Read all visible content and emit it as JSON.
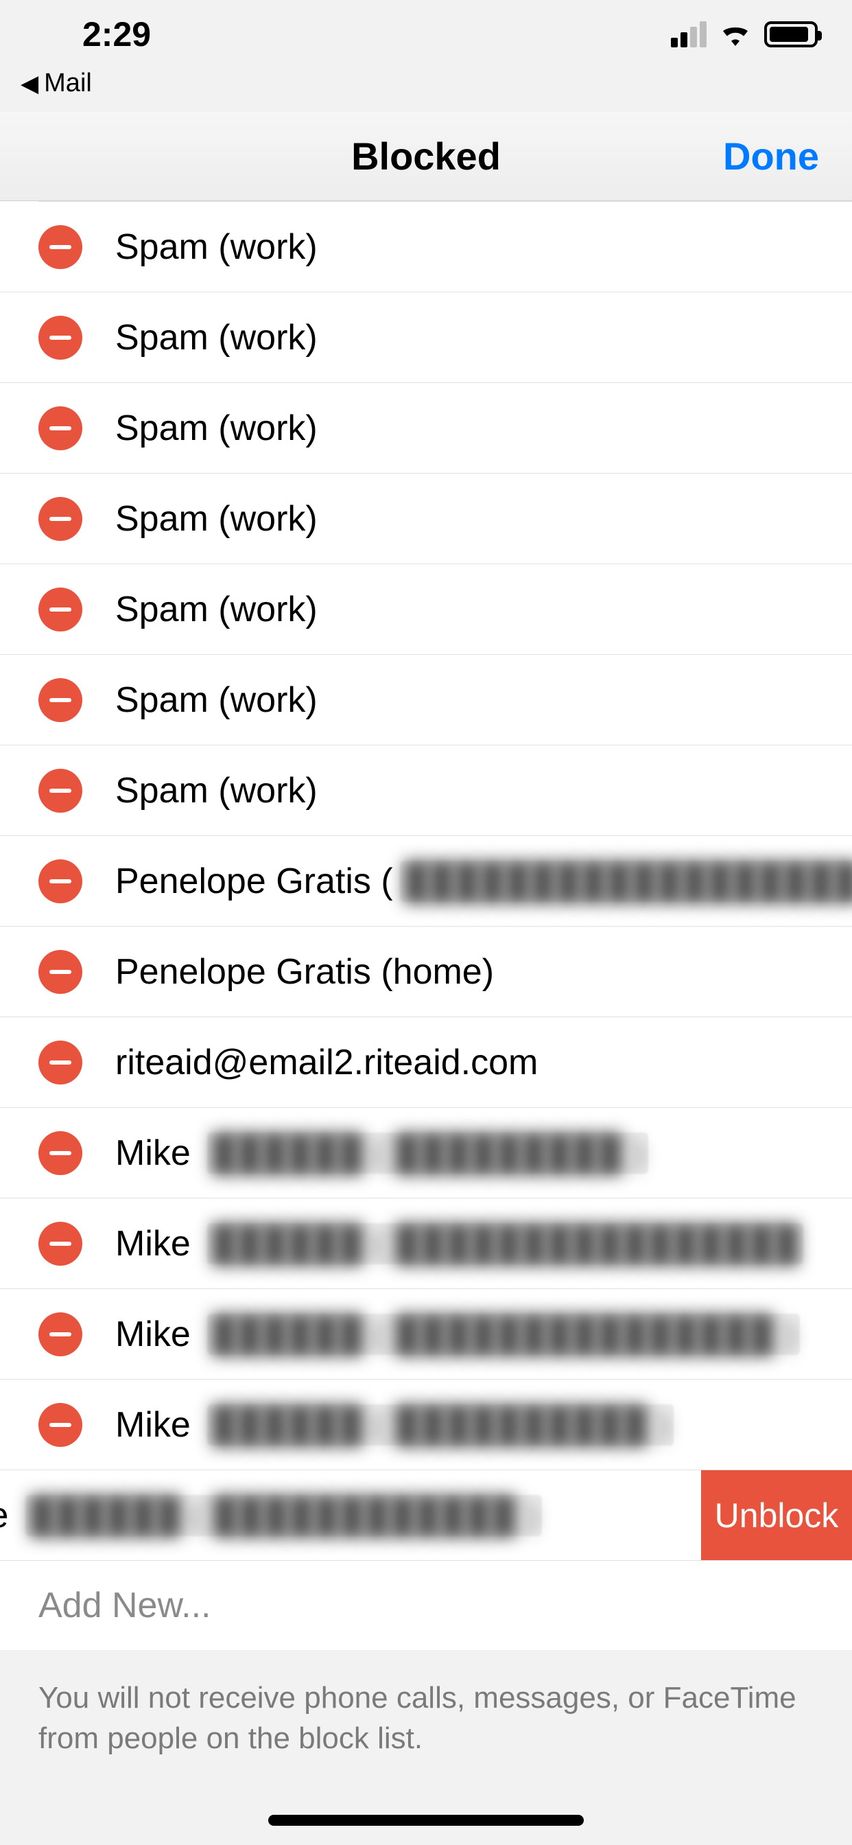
{
  "status": {
    "time": "2:29"
  },
  "breadcrumb": {
    "label": "Mail"
  },
  "nav": {
    "title": "Blocked",
    "done": "Done"
  },
  "rows": [
    {
      "text": "Spam (work)",
      "redacted_suffix": ""
    },
    {
      "text": "Spam (work)",
      "redacted_suffix": ""
    },
    {
      "text": "Spam (work)",
      "redacted_suffix": ""
    },
    {
      "text": "Spam (work)",
      "redacted_suffix": ""
    },
    {
      "text": "Spam (work)",
      "redacted_suffix": ""
    },
    {
      "text": "Spam (work)",
      "redacted_suffix": ""
    },
    {
      "text": "Spam (work)",
      "redacted_suffix": ""
    },
    {
      "text": "Penelope Gratis (",
      "redacted_suffix": "██████████████████"
    },
    {
      "text": "Penelope Gratis (home)",
      "redacted_suffix": ""
    },
    {
      "text": "riteaid@email2.riteaid.com",
      "redacted_suffix": ""
    },
    {
      "text": "Mike ",
      "redacted_suffix": "██████ ( █████████ )"
    },
    {
      "text": "Mike ",
      "redacted_suffix": "██████ ( ████████████████"
    },
    {
      "text": "Mike ",
      "redacted_suffix": "██████ ( ███████████████ )"
    },
    {
      "text": "Mike ",
      "redacted_suffix": "██████ ( ██████████ )"
    }
  ],
  "swiped_row": {
    "text": "ike ",
    "redacted_suffix": "██████ ( ████████████ )",
    "action": "Unblock"
  },
  "add_new": "Add New...",
  "footer": "You will not receive phone calls, messages, or FaceTime from people on the block list."
}
